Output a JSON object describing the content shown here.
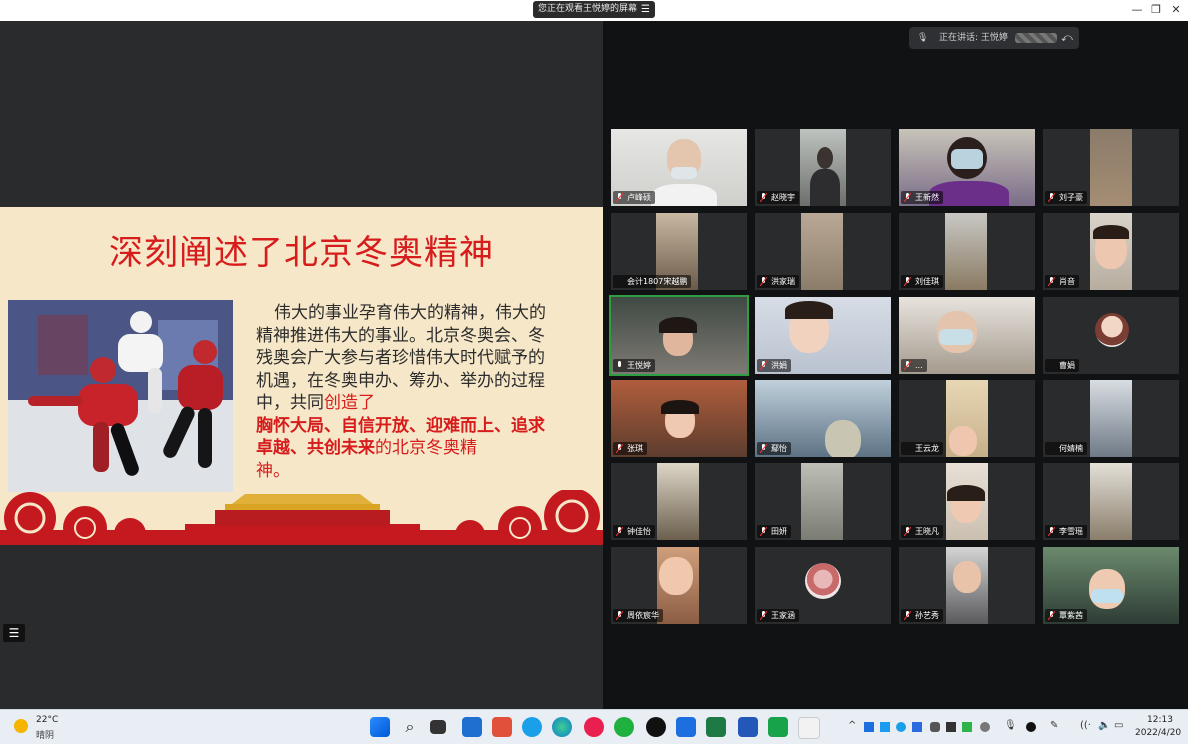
{
  "window": {
    "viewing_banner": "您正在观看王悦婷的屏幕",
    "menu_icon": "menu-icon",
    "minimize": "—",
    "restore": "❐",
    "close": "✕"
  },
  "slide": {
    "title": "深刻阐述了北京冬奥精神",
    "text_normal": "伟大的事业孕育伟大的精神，伟大的精神推进伟大的事业。北京冬奥会、冬残奥会广大参与者珍惜伟大时代赋予的机遇，在冬奥申办、筹办、举办的过程中，共同",
    "text_red": "创造了",
    "text_bold": "胸怀大局、自信开放、迎难而上、追求卓越、共创未来",
    "text_red_tail": "的北京冬奥精",
    "text_end": "神。",
    "accent_color": "#d71c1c"
  },
  "speaker": {
    "label": "正在讲话: 王悦婷"
  },
  "participants": [
    {
      "name": "卢峰硕"
    },
    {
      "name": "赵晓宇"
    },
    {
      "name": "王新然"
    },
    {
      "name": "刘子豪"
    },
    {
      "name": "会计1807宋越鹏"
    },
    {
      "name": "洪家瑞"
    },
    {
      "name": "刘佳琪"
    },
    {
      "name": "肖音"
    },
    {
      "name": "王悦婷"
    },
    {
      "name": "洪娟"
    },
    {
      "name": "..."
    },
    {
      "name": "曹娟"
    },
    {
      "name": "张琪"
    },
    {
      "name": "鄢怡"
    },
    {
      "name": "王云龙"
    },
    {
      "name": "何婧楠"
    },
    {
      "name": "钟佳怡"
    },
    {
      "name": "田妍"
    },
    {
      "name": "王晓凡"
    },
    {
      "name": "李雪瑶"
    },
    {
      "name": "周依宸华"
    },
    {
      "name": "王家涵"
    },
    {
      "name": "孙艺秀"
    },
    {
      "name": "覃紫茜"
    }
  ],
  "taskbar": {
    "weather_temp": "22°C",
    "weather_desc": "晴阴",
    "time": "12:13",
    "date": "2022/4/20"
  }
}
